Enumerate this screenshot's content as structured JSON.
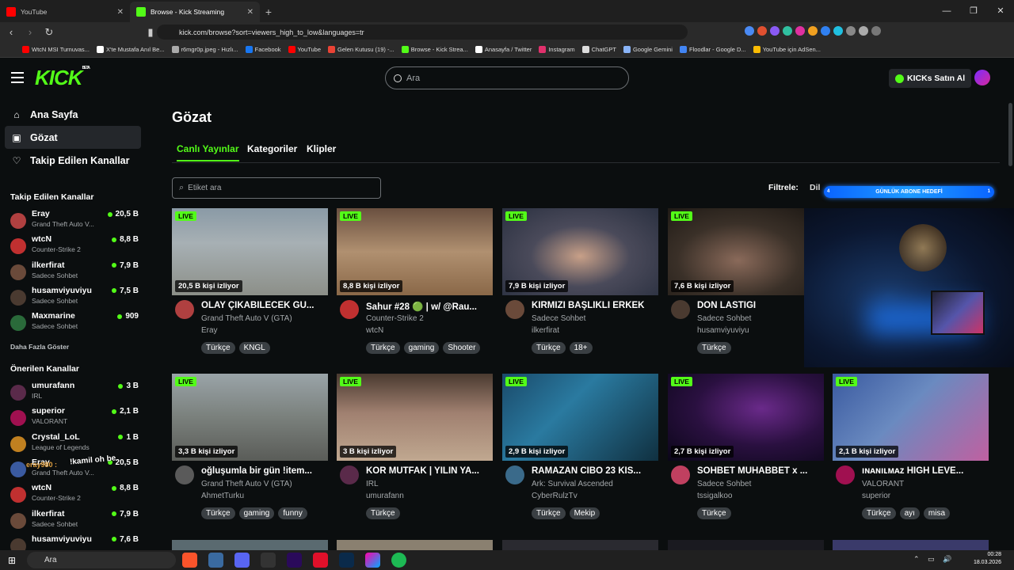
{
  "browser": {
    "tabs": [
      {
        "label": "YouTube",
        "color": "#ff0000",
        "active": false
      },
      {
        "label": "Browse - Kick Streaming",
        "color": "#53fc18",
        "active": true
      }
    ],
    "url": "kick.com/browse?sort=viewers_high_to_low&languages=tr",
    "bookmarks": [
      {
        "label": "WtcN MSI Turnuvas...",
        "color": "#ff0000"
      },
      {
        "label": "X'te Mustafa Anıl Be...",
        "color": "#ffffff"
      },
      {
        "label": "r6mgr0p.jpeg - Hızlı...",
        "color": "#aaaaaa"
      },
      {
        "label": "Facebook",
        "color": "#1877f2"
      },
      {
        "label": "YouTube",
        "color": "#ff0000"
      },
      {
        "label": "Gelen Kutusu (19) -...",
        "color": "#ea4335"
      },
      {
        "label": "Browse - Kick Strea...",
        "color": "#53fc18"
      },
      {
        "label": "Anasayfa / Twitter",
        "color": "#ffffff"
      },
      {
        "label": "Instagram",
        "color": "#e1306c"
      },
      {
        "label": "ChatGPT",
        "color": "#dddddd"
      },
      {
        "label": "Google Gemini",
        "color": "#8ab4f8"
      },
      {
        "label": "Floodlar - Google D...",
        "color": "#4285f4"
      },
      {
        "label": "YouTube için AdSen...",
        "color": "#fbbc04"
      }
    ]
  },
  "header": {
    "logo": "KICK",
    "logo_badge": "BETA",
    "search_placeholder": "Ara",
    "kicks_button": "KICKs Satın Al"
  },
  "sidebar": {
    "nav": [
      {
        "label": "Ana Sayfa",
        "icon": "home-icon"
      },
      {
        "label": "Gözat",
        "icon": "browse-icon",
        "active": true
      },
      {
        "label": "Takip Edilen Kanallar",
        "icon": "heart-icon"
      }
    ],
    "followed_heading": "Takip Edilen Kanallar",
    "followed": [
      {
        "name": "Eray",
        "game": "Grand Theft Auto V...",
        "viewers": "20,5 B",
        "color": "#b04040"
      },
      {
        "name": "wtcN",
        "game": "Counter-Strike 2",
        "viewers": "8,8 B",
        "color": "#c03030"
      },
      {
        "name": "ilkerfirat",
        "game": "Sadece Sohbet",
        "viewers": "7,9 B",
        "color": "#6a4a3a"
      },
      {
        "name": "husamviyuviyu",
        "game": "Sadece Sohbet",
        "viewers": "7,5 B",
        "color": "#4a3a30"
      },
      {
        "name": "Maxmarine",
        "game": "Sadece Sohbet",
        "viewers": "909",
        "color": "#2a6a3a"
      }
    ],
    "show_more": "Daha Fazla Göster",
    "recommended_heading": "Önerilen Kanallar",
    "recommended": [
      {
        "name": "umurafann",
        "game": "IRL",
        "viewers": "3 B",
        "color": "#5a2a4a"
      },
      {
        "name": "superior",
        "game": "VALORANT",
        "viewers": "2,1 B",
        "color": "#a01050"
      },
      {
        "name": "Crystal_LoL",
        "game": "League of Legends",
        "viewers": "1 B",
        "color": "#c08020"
      },
      {
        "name": "Eray",
        "game": "Grand Theft Auto V...",
        "viewers": "20,5 B",
        "color": "#3a5aa0"
      },
      {
        "name": "wtcN",
        "game": "Counter-Strike 2",
        "viewers": "8,8 B",
        "color": "#c03030"
      },
      {
        "name": "ilkerfirat",
        "game": "Sadece Sohbet",
        "viewers": "7,9 B",
        "color": "#6a4a3a"
      },
      {
        "name": "husamviyuviyu",
        "game": "",
        "viewers": "7,6 B",
        "color": "#4a3a30"
      }
    ]
  },
  "overlay": {
    "chat_text": "!kamil oh be",
    "chat_name": "eray980 :"
  },
  "main": {
    "title": "Gözat",
    "tabs": [
      "Canlı Yayınlar",
      "Kategoriler",
      "Klipler"
    ],
    "tag_search_placeholder": "Etiket ara",
    "filter_label": "Filtrele:",
    "filter_value": "Dil",
    "goal_banner": {
      "text": "GÜNLÜK ABONE HEDEFİ",
      "left": "4",
      "right": "1"
    },
    "live_badge": "LIVE",
    "row1": [
      {
        "viewers": "20,5 B kişi izliyor",
        "title": "OLAY ÇIKABİLECEK GÜ...",
        "category": "Grand Theft Auto V (GTA)",
        "user": "Eray",
        "tags": [
          "Türkçe",
          "KNGL"
        ],
        "bg": "linear-gradient(180deg,#8a9aa6 0%,#a7b0b4 40%,#8c8f88 100%)",
        "av": "#b04040"
      },
      {
        "viewers": "8,8 B kişi izliyor",
        "title": "Sahur #28 🟢 | w/ @Rau...",
        "category": "Counter-Strike 2",
        "user": "wtcN",
        "tags": [
          "Türkçe",
          "gaming",
          "Shooter"
        ],
        "bg": "linear-gradient(180deg,#6a5040 0%,#b09070 50%,#8a6848 100%)",
        "av": "#c03030"
      },
      {
        "viewers": "7,9 B kişi izliyor",
        "title": "KIRMIZI BAŞLIKLI ERKEK",
        "category": "Sadece Sohbet",
        "user": "ilkerfirat",
        "tags": [
          "Türkçe",
          "18+"
        ],
        "bg": "radial-gradient(ellipse at 50% 55%,#c8a088 0%,#4a4a5a 45%,#2a3040 100%)",
        "av": "#6a4a3a"
      },
      {
        "viewers": "7,6 B kişi izliyor",
        "title": "DON LASTİĞİ",
        "category": "Sadece Sohbet",
        "user": "husamviyuviyu",
        "tags": [
          "Türkçe"
        ],
        "bg": "radial-gradient(ellipse at 45% 60%,#8a6a5a 0%,#3a3028 50%,#1a1612 100%)",
        "av": "#4a3a30"
      }
    ],
    "row2": [
      {
        "viewers": "3,3 B kişi izliyor",
        "title": "oğluşumla bir gün !item...",
        "category": "Grand Theft Auto V (GTA)",
        "user": "AhmetTurku",
        "tags": [
          "Türkçe",
          "gaming",
          "funny"
        ],
        "bg": "linear-gradient(180deg,#9aa4a8 0%,#7a807c 50%,#5a5c58 100%)",
        "av": "#5a5a5a"
      },
      {
        "viewers": "3 B kişi izliyor",
        "title": "KÖR MUTFAK | YILIN YA...",
        "category": "IRL",
        "user": "umurafann",
        "tags": [
          "Türkçe"
        ],
        "bg": "linear-gradient(180deg,#4a3a30 0%,#a08070 45%,#c0a890 100%)",
        "av": "#5a2a4a"
      },
      {
        "viewers": "2,9 B kişi izliyor",
        "title": "RAMAZAN CİBO 23 KIS...",
        "category": "Ark: Survival Ascended",
        "user": "CyberRulzTv",
        "tags": [
          "Türkçe",
          "Mekip"
        ],
        "bg": "linear-gradient(135deg,#1a4a6a 0%,#2a7aa0 40%,#103040 100%)",
        "av": "#3a6a8a"
      },
      {
        "viewers": "2,7 B kişi izliyor",
        "title": "SOHBET MUHABBET x ...",
        "category": "Sadece Sohbet",
        "user": "tssigalkoo",
        "tags": [
          "Türkçe"
        ],
        "bg": "radial-gradient(ellipse at 60% 40%,#6a2a8a 0%,#2a1040 50%,#0a0618 100%)",
        "av": "#c04060"
      },
      {
        "viewers": "2,1 B kişi izliyor",
        "title": "ıɴᴀɴıʟᴍᴀᴢ HIGH LEVE...",
        "category": "VALORANT",
        "user": "superior",
        "tags": [
          "Türkçe",
          "ayı",
          "misa"
        ],
        "bg": "linear-gradient(135deg,#3a5aa0 0%,#6a8ac0 45%,#c060a0 100%)",
        "av": "#a01050"
      }
    ]
  },
  "taskbar": {
    "search_placeholder": "Ara",
    "time": "00:28",
    "date": "18.03.2026"
  }
}
